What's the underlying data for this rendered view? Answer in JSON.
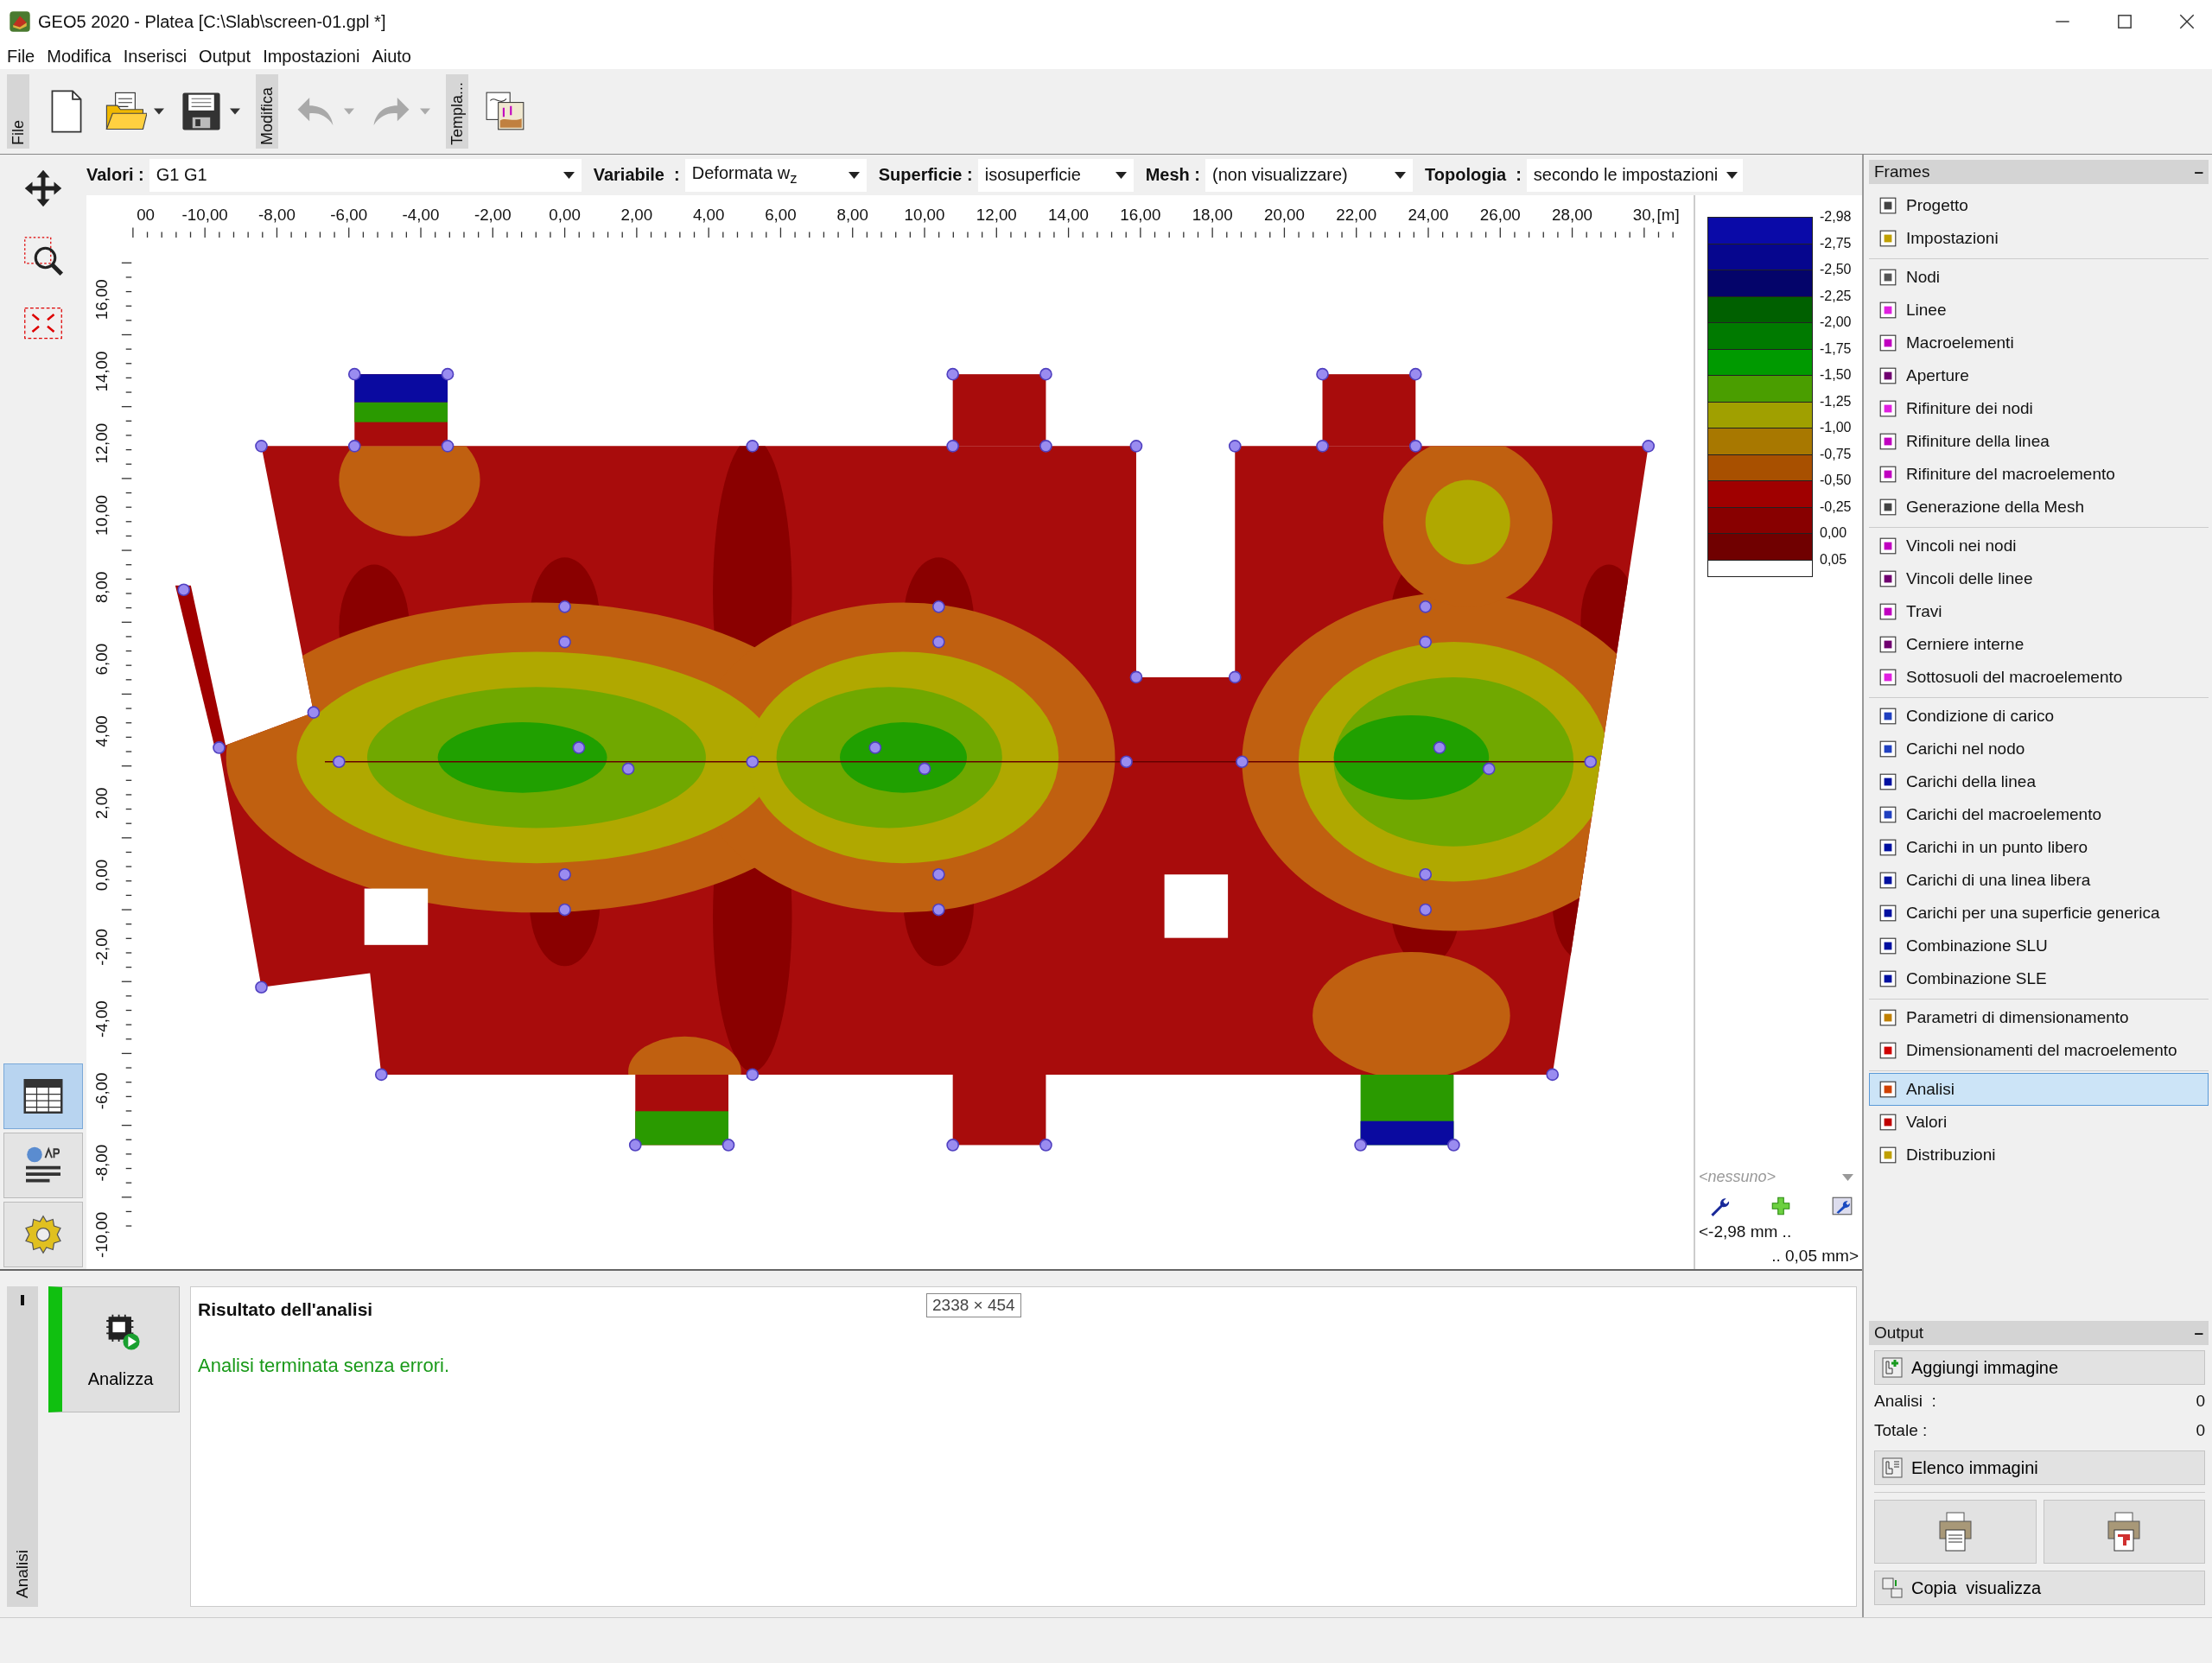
{
  "window": {
    "title": "GEO5 2020 - Platea [C:\\Slab\\screen-01.gpl *]"
  },
  "menu": [
    "File",
    "Modifica",
    "Inserisci",
    "Output",
    "Impostazioni",
    "Aiuto"
  ],
  "toolbar": [
    {
      "kind": "tab",
      "label": "File"
    },
    {
      "kind": "new"
    },
    {
      "kind": "open"
    },
    {
      "kind": "save"
    },
    {
      "kind": "tab",
      "label": "Modifica"
    },
    {
      "kind": "undo",
      "disabled": true
    },
    {
      "kind": "redo",
      "disabled": true
    },
    {
      "kind": "tab",
      "label": "Templa..."
    },
    {
      "kind": "template"
    }
  ],
  "filters": [
    {
      "label": "Valori :",
      "value": "G1 G1"
    },
    {
      "label": "Variabile  :",
      "value": "Deformata w$_{z}$"
    },
    {
      "label": "Superficie :",
      "value": "isosuperficie"
    },
    {
      "label": "Mesh :",
      "value": "(non visualizzare)"
    },
    {
      "label": "Topologia  :",
      "value": "secondo le impostazioni"
    }
  ],
  "view_buttons": [
    {
      "selected": true
    },
    {
      "selected": false
    },
    {
      "selected": false
    }
  ],
  "ruler": {
    "x_labels": [
      "00",
      "-10,00",
      "-8,00",
      "-6,00",
      "-4,00",
      "-2,00",
      "0,00",
      "2,00",
      "4,00",
      "6,00",
      "8,00",
      "10,00",
      "12,00",
      "14,00",
      "16,00",
      "18,00",
      "20,00",
      "22,00",
      "24,00",
      "26,00",
      "28,00",
      "30,"
    ],
    "unit": "[m]",
    "y_labels": [
      "16,00",
      "14,00",
      "12,00",
      "10,00",
      "8,00",
      "6,00",
      "4,00",
      "2,00",
      "0,00",
      "-2,00",
      "-4,00",
      "-6,00",
      "-8,00",
      "-10,00"
    ]
  },
  "legend": {
    "values": [
      "-2,98",
      "-2,75",
      "-2,50",
      "-2,25",
      "-2,00",
      "-1,75",
      "-1,50",
      "-1,25",
      "-1,00",
      "-0,75",
      "-0,50",
      "-0,25",
      "0,00",
      "0,05"
    ],
    "bands": [
      {
        "color": "#0a0aa8"
      },
      {
        "color": "#06068e"
      },
      {
        "color": "#04046a"
      },
      {
        "color": "#006000"
      },
      {
        "color": "#007a00"
      },
      {
        "color": "#009a00"
      },
      {
        "color": "#4a9e00"
      },
      {
        "color": "#a0a000"
      },
      {
        "color": "#a87800"
      },
      {
        "color": "#a85000"
      },
      {
        "color": "#a00000"
      },
      {
        "color": "#880000"
      },
      {
        "color": "#700000"
      }
    ],
    "selector": {
      "placeholder": "<nessuno>"
    },
    "range_min": "<-2,98 mm ..",
    "range_max": ".. 0,05 mm>"
  },
  "frames": {
    "title": "Frames",
    "collapse": "–",
    "groups": [
      [
        {
          "label": "Progetto",
          "selected": false
        },
        {
          "label": "Impostazioni",
          "selected": false
        }
      ],
      [
        {
          "label": "Nodi",
          "selected": false
        },
        {
          "label": "Linee",
          "selected": false
        },
        {
          "label": "Macroelementi",
          "selected": false
        },
        {
          "label": "Aperture",
          "selected": false
        },
        {
          "label": "Rifiniture dei nodi",
          "selected": false
        },
        {
          "label": "Rifiniture della linea",
          "selected": false
        },
        {
          "label": "Rifiniture del macroelemento",
          "selected": false
        },
        {
          "label": "Generazione della Mesh",
          "selected": false
        }
      ],
      [
        {
          "label": "Vincoli nei nodi",
          "selected": false
        },
        {
          "label": "Vincoli delle linee",
          "selected": false
        },
        {
          "label": "Travi",
          "selected": false
        },
        {
          "label": "Cerniere interne",
          "selected": false
        },
        {
          "label": "Sottosuoli del macroelemento",
          "selected": false
        }
      ],
      [
        {
          "label": "Condizione di carico",
          "selected": false
        },
        {
          "label": "Carichi nel nodo",
          "selected": false
        },
        {
          "label": "Carichi della linea",
          "selected": false
        },
        {
          "label": "Carichi del macroelemento",
          "selected": false
        },
        {
          "label": "Carichi in un punto libero",
          "selected": false
        },
        {
          "label": "Carichi di una linea libera",
          "selected": false
        },
        {
          "label": "Carichi per una superficie generica",
          "selected": false
        },
        {
          "label": "Combinazione SLU",
          "selected": false
        },
        {
          "label": "Combinazione SLE",
          "selected": false
        }
      ],
      [
        {
          "label": "Parametri di dimensionamento",
          "selected": false
        },
        {
          "label": "Dimensionamenti del macroelemento",
          "selected": false
        }
      ],
      [
        {
          "label": "Analisi",
          "selected": true
        },
        {
          "label": "Valori",
          "selected": false
        },
        {
          "label": "Distribuzioni",
          "selected": false
        }
      ]
    ]
  },
  "output": {
    "title": "Output",
    "collapse": "–",
    "add_button": "Aggiungi immagine",
    "stats": [
      {
        "label": "Analisi  :",
        "value": "0"
      },
      {
        "label": "Totale :",
        "value": "0"
      }
    ],
    "list_button": "Elenco immagini",
    "copy_button": "Copia  visualizza"
  },
  "analysis": {
    "tab": "Analisi",
    "button": "Analizza",
    "heading": "Risultato dell'analisi",
    "message": "Analisi terminata senza errori.",
    "tooltip": "2338 × 454"
  }
}
